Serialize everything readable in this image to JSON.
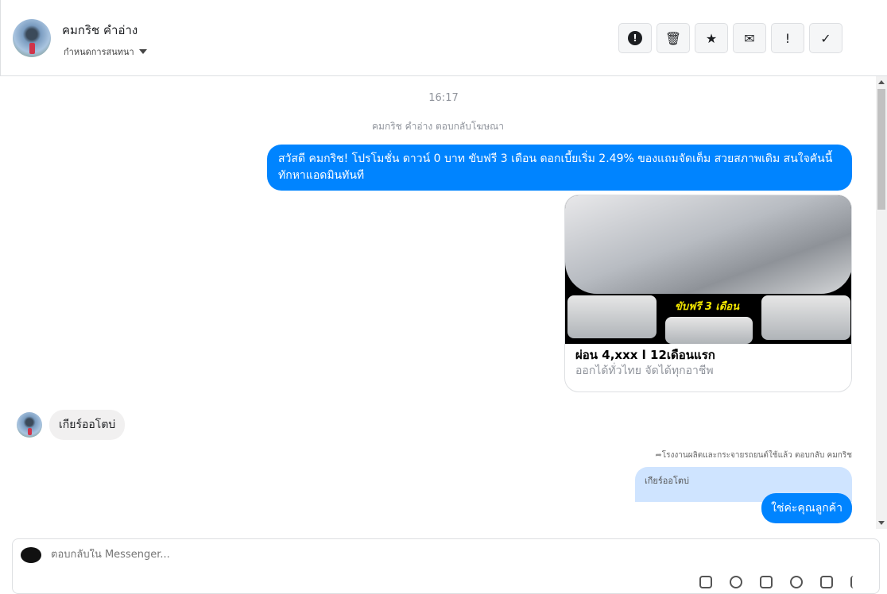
{
  "header": {
    "name": "คมกริช คําอ่าง",
    "assign_label": "กําหนดการสนทนา",
    "tools": [
      {
        "icon": "alert-icon",
        "glyph": "!"
      },
      {
        "icon": "trash-icon",
        "glyph": "🗑"
      },
      {
        "icon": "star-icon",
        "glyph": "★"
      },
      {
        "icon": "envelope-icon",
        "glyph": "✉"
      },
      {
        "icon": "exclamation-icon",
        "glyph": "!"
      },
      {
        "icon": "check-icon",
        "glyph": "✓"
      }
    ]
  },
  "chat": {
    "time": "16:17",
    "system_note": "คมกริช คําอ่าง ตอบกลับโฆษณา",
    "ad_message": "สวัสดี คมกริช! โปรโมชั่น ดาวน์ 0 บาท ขับฟรี 3 เดือน ดอกเบี้ยเริ่ม 2.49% ของแถมจัดเต็ม สวยสภาพเดิม สนใจคันนี้ทักหาแอดมินทันที",
    "card": {
      "image_text": "ขับฟรี 3 เดือน",
      "title": "ผ่อน 4,xxx l 12เดือนแรก",
      "subtitle": "ออกได้ทั่วไทย จัดได้ทุกอาชีพ"
    },
    "customer_message": "เกียร์ออโตบ่",
    "reply_meta": "โรงงานผลิตและกระจายรถยนต์ใช้แล้ว ตอบกลับ คมกริช",
    "quoted": "เกียร์ออโตบ่",
    "reply": "ใช่ค่ะคุณลูกค้า"
  },
  "composer": {
    "placeholder": "ตอบกลับใน Messenger..."
  }
}
